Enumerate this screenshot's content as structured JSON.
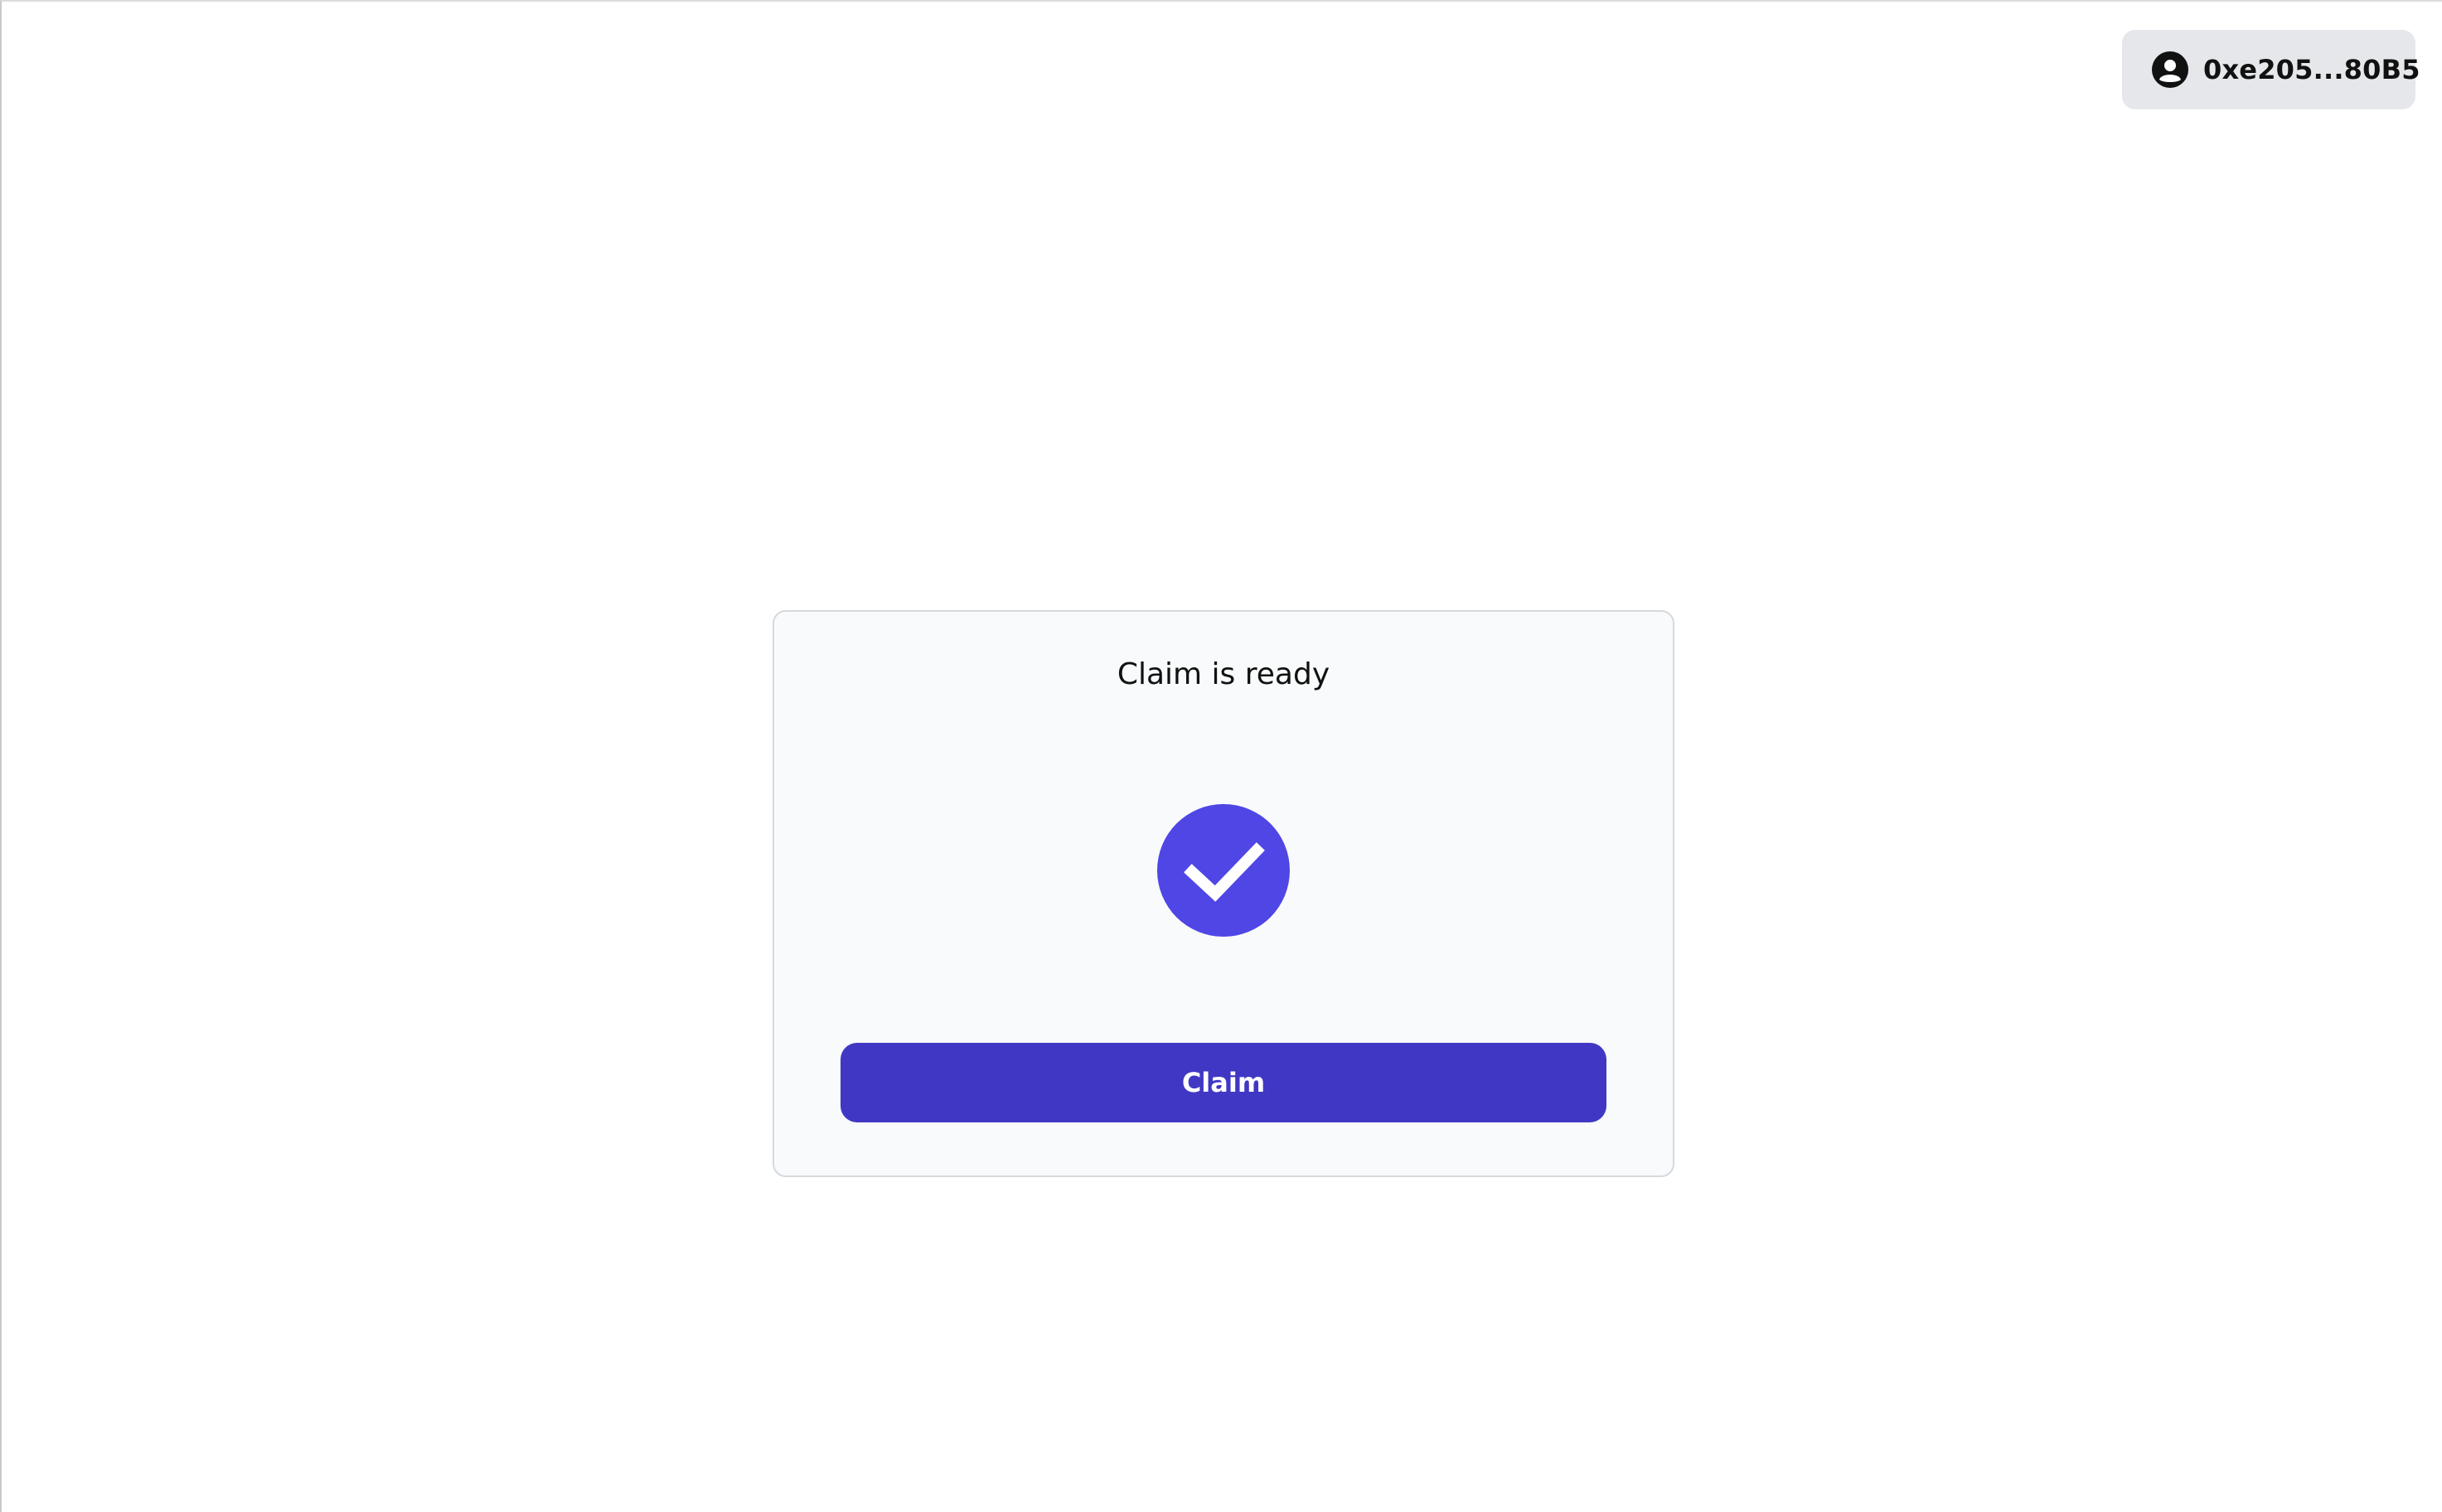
{
  "header": {
    "account": {
      "address": "0xe205...80B5",
      "icon": "user-circle-icon"
    }
  },
  "claim_card": {
    "title": "Claim is ready",
    "status_icon": "check-circle-icon",
    "button_label": "Claim"
  },
  "colors": {
    "accent": "#4f46e5",
    "button": "#4038c4",
    "card_background": "#f9fafb",
    "account_button_background": "#e5e7eb"
  }
}
